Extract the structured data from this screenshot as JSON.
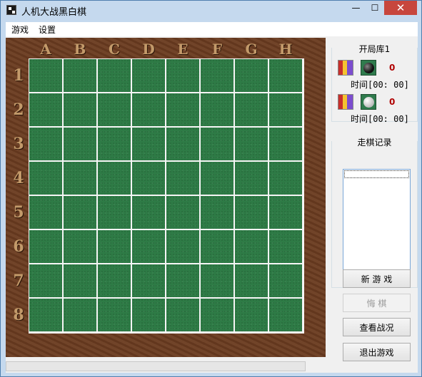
{
  "window": {
    "title": "人机大战黑白棋",
    "min_glyph": "—",
    "max_glyph": "☐",
    "close_glyph": "✕"
  },
  "menu": {
    "items": [
      "游戏",
      "设置"
    ]
  },
  "board": {
    "columns": [
      "A",
      "B",
      "C",
      "D",
      "E",
      "F",
      "G",
      "H"
    ],
    "rows": [
      "1",
      "2",
      "3",
      "4",
      "5",
      "6",
      "7",
      "8"
    ],
    "cell_color": "#2e7b46",
    "frame_color": "#6b3c20"
  },
  "side_panel": {
    "opening_group_title": "开局库1",
    "players": [
      {
        "icon": "player-icon",
        "stone": "black",
        "count": "0",
        "time": "时间[00: 00]"
      },
      {
        "icon": "player-icon",
        "stone": "white",
        "count": "0",
        "time": "时间[00: 00]"
      }
    ],
    "record_group_title": "走棋记录",
    "buttons": {
      "new_game": "新 游 戏",
      "undo": "悔   棋",
      "view_status": "查看战况",
      "exit_game": "退出游戏"
    }
  },
  "colors": {
    "count_red": "#b00000",
    "close_red": "#c7463d",
    "list_border": "#7aa7d8"
  }
}
